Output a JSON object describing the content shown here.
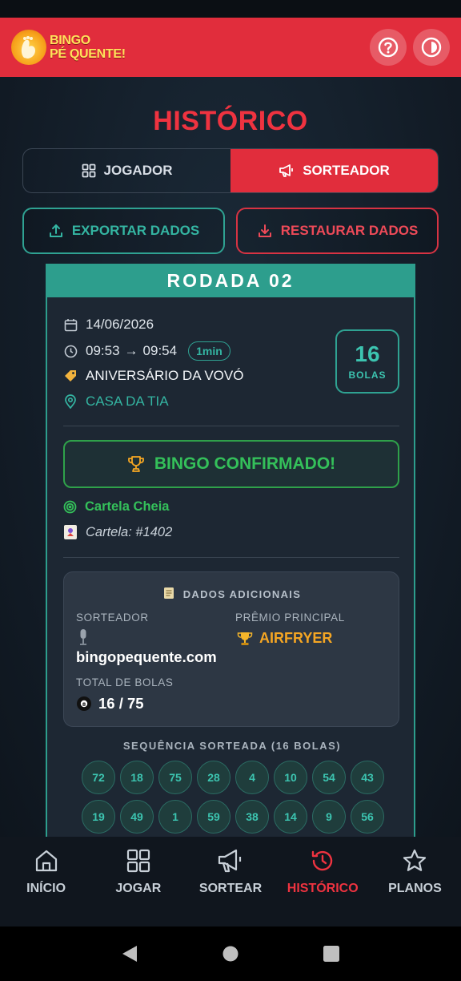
{
  "app": {
    "logo_line1": "BINGO",
    "logo_line2": "PÉ QUENTE!"
  },
  "page": {
    "title": "HISTÓRICO"
  },
  "segments": [
    {
      "label": "JOGADOR",
      "icon": "grid-icon",
      "active": false
    },
    {
      "label": "SORTEADOR",
      "icon": "megaphone-icon",
      "active": true
    }
  ],
  "actions": {
    "export_label": "EXPORTAR DADOS",
    "restore_label": "RESTAURAR DADOS"
  },
  "round": {
    "title": "RODADA 02",
    "date": "14/06/2026",
    "time_start": "09:53",
    "arrow": "→",
    "time_end": "09:54",
    "duration": "1min",
    "event_name": "ANIVERSÁRIO DA VOVÓ",
    "location": "CASA DA TIA",
    "balls_count": "16",
    "balls_label": "BOLAS",
    "bingo_label": "BINGO CONFIRMADO!",
    "pattern": "Cartela Cheia",
    "card": "Cartela: #1402",
    "extra": {
      "title": "DADOS ADICIONAIS",
      "drawer_label": "SORTEADOR",
      "drawer_value": "bingopequente.com",
      "prize_label": "PRÊMIO PRINCIPAL",
      "prize_value": "AIRFRYER",
      "total_label": "TOTAL DE BOLAS",
      "total_value": "16 / 75"
    },
    "sequence_title": "SEQUÊNCIA SORTEADA (16 BOLAS)",
    "sequence": [
      "72",
      "18",
      "75",
      "28",
      "4",
      "10",
      "54",
      "43",
      "19",
      "49",
      "1",
      "59",
      "38",
      "14",
      "9",
      "56"
    ]
  },
  "nav": [
    {
      "label": "INÍCIO",
      "icon": "home-icon",
      "active": false
    },
    {
      "label": "JOGAR",
      "icon": "grid-icon",
      "active": false
    },
    {
      "label": "SORTEAR",
      "icon": "megaphone-icon",
      "active": false
    },
    {
      "label": "HISTÓRICO",
      "icon": "history-icon",
      "active": true
    },
    {
      "label": "PLANOS",
      "icon": "star-icon",
      "active": false
    }
  ],
  "colors": {
    "brand_red": "#e12d3c",
    "teal": "#2d9e8d",
    "green": "#34c05a",
    "gold": "#f5a623"
  }
}
